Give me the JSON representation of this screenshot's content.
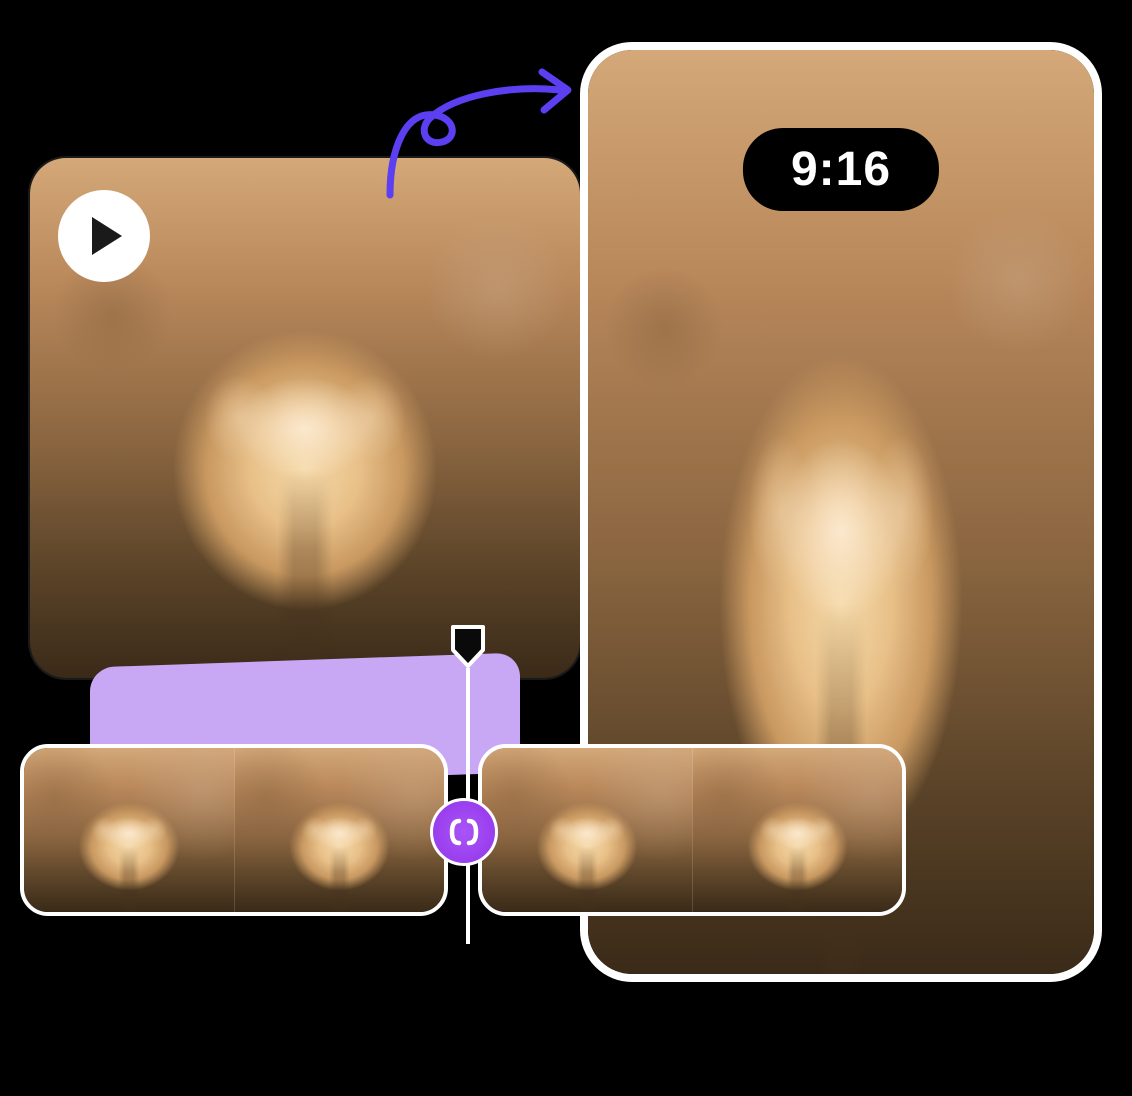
{
  "result": {
    "aspect_ratio_label": "9:16"
  },
  "source": {
    "subject": "puppy-running",
    "play_icon": "play-icon"
  },
  "arrow": {
    "icon": "curly-arrow-right-icon",
    "color": "#5b3ff0"
  },
  "timeline": {
    "playhead_icon": "playhead-icon",
    "split_icon": "split-clip-icon",
    "split_color": "#9333ea",
    "clip_groups": [
      {
        "frames": [
          "puppy-frame",
          "puppy-frame"
        ]
      },
      {
        "frames": [
          "puppy-frame",
          "puppy-frame"
        ]
      }
    ]
  }
}
